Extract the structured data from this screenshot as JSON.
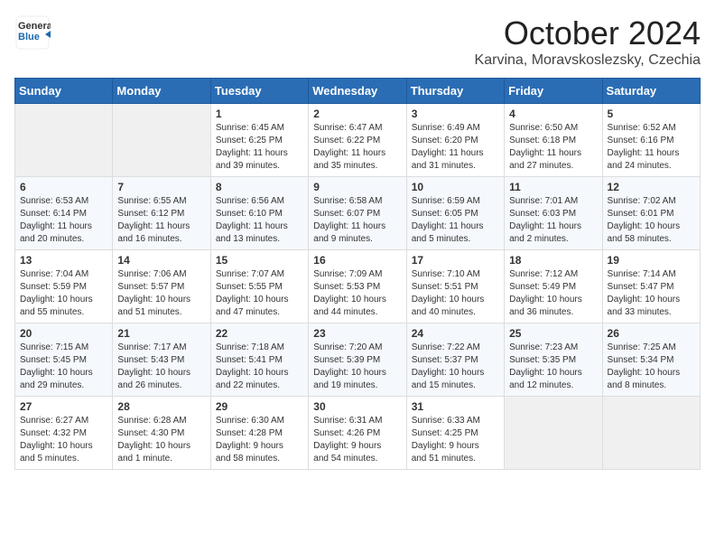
{
  "header": {
    "logo_line1": "General",
    "logo_line2": "Blue",
    "month": "October 2024",
    "location": "Karvina, Moravskoslezsky, Czechia"
  },
  "weekdays": [
    "Sunday",
    "Monday",
    "Tuesday",
    "Wednesday",
    "Thursday",
    "Friday",
    "Saturday"
  ],
  "weeks": [
    [
      {
        "day": "",
        "info": ""
      },
      {
        "day": "",
        "info": ""
      },
      {
        "day": "1",
        "info": "Sunrise: 6:45 AM\nSunset: 6:25 PM\nDaylight: 11 hours\nand 39 minutes."
      },
      {
        "day": "2",
        "info": "Sunrise: 6:47 AM\nSunset: 6:22 PM\nDaylight: 11 hours\nand 35 minutes."
      },
      {
        "day": "3",
        "info": "Sunrise: 6:49 AM\nSunset: 6:20 PM\nDaylight: 11 hours\nand 31 minutes."
      },
      {
        "day": "4",
        "info": "Sunrise: 6:50 AM\nSunset: 6:18 PM\nDaylight: 11 hours\nand 27 minutes."
      },
      {
        "day": "5",
        "info": "Sunrise: 6:52 AM\nSunset: 6:16 PM\nDaylight: 11 hours\nand 24 minutes."
      }
    ],
    [
      {
        "day": "6",
        "info": "Sunrise: 6:53 AM\nSunset: 6:14 PM\nDaylight: 11 hours\nand 20 minutes."
      },
      {
        "day": "7",
        "info": "Sunrise: 6:55 AM\nSunset: 6:12 PM\nDaylight: 11 hours\nand 16 minutes."
      },
      {
        "day": "8",
        "info": "Sunrise: 6:56 AM\nSunset: 6:10 PM\nDaylight: 11 hours\nand 13 minutes."
      },
      {
        "day": "9",
        "info": "Sunrise: 6:58 AM\nSunset: 6:07 PM\nDaylight: 11 hours\nand 9 minutes."
      },
      {
        "day": "10",
        "info": "Sunrise: 6:59 AM\nSunset: 6:05 PM\nDaylight: 11 hours\nand 5 minutes."
      },
      {
        "day": "11",
        "info": "Sunrise: 7:01 AM\nSunset: 6:03 PM\nDaylight: 11 hours\nand 2 minutes."
      },
      {
        "day": "12",
        "info": "Sunrise: 7:02 AM\nSunset: 6:01 PM\nDaylight: 10 hours\nand 58 minutes."
      }
    ],
    [
      {
        "day": "13",
        "info": "Sunrise: 7:04 AM\nSunset: 5:59 PM\nDaylight: 10 hours\nand 55 minutes."
      },
      {
        "day": "14",
        "info": "Sunrise: 7:06 AM\nSunset: 5:57 PM\nDaylight: 10 hours\nand 51 minutes."
      },
      {
        "day": "15",
        "info": "Sunrise: 7:07 AM\nSunset: 5:55 PM\nDaylight: 10 hours\nand 47 minutes."
      },
      {
        "day": "16",
        "info": "Sunrise: 7:09 AM\nSunset: 5:53 PM\nDaylight: 10 hours\nand 44 minutes."
      },
      {
        "day": "17",
        "info": "Sunrise: 7:10 AM\nSunset: 5:51 PM\nDaylight: 10 hours\nand 40 minutes."
      },
      {
        "day": "18",
        "info": "Sunrise: 7:12 AM\nSunset: 5:49 PM\nDaylight: 10 hours\nand 36 minutes."
      },
      {
        "day": "19",
        "info": "Sunrise: 7:14 AM\nSunset: 5:47 PM\nDaylight: 10 hours\nand 33 minutes."
      }
    ],
    [
      {
        "day": "20",
        "info": "Sunrise: 7:15 AM\nSunset: 5:45 PM\nDaylight: 10 hours\nand 29 minutes."
      },
      {
        "day": "21",
        "info": "Sunrise: 7:17 AM\nSunset: 5:43 PM\nDaylight: 10 hours\nand 26 minutes."
      },
      {
        "day": "22",
        "info": "Sunrise: 7:18 AM\nSunset: 5:41 PM\nDaylight: 10 hours\nand 22 minutes."
      },
      {
        "day": "23",
        "info": "Sunrise: 7:20 AM\nSunset: 5:39 PM\nDaylight: 10 hours\nand 19 minutes."
      },
      {
        "day": "24",
        "info": "Sunrise: 7:22 AM\nSunset: 5:37 PM\nDaylight: 10 hours\nand 15 minutes."
      },
      {
        "day": "25",
        "info": "Sunrise: 7:23 AM\nSunset: 5:35 PM\nDaylight: 10 hours\nand 12 minutes."
      },
      {
        "day": "26",
        "info": "Sunrise: 7:25 AM\nSunset: 5:34 PM\nDaylight: 10 hours\nand 8 minutes."
      }
    ],
    [
      {
        "day": "27",
        "info": "Sunrise: 6:27 AM\nSunset: 4:32 PM\nDaylight: 10 hours\nand 5 minutes."
      },
      {
        "day": "28",
        "info": "Sunrise: 6:28 AM\nSunset: 4:30 PM\nDaylight: 10 hours\nand 1 minute."
      },
      {
        "day": "29",
        "info": "Sunrise: 6:30 AM\nSunset: 4:28 PM\nDaylight: 9 hours\nand 58 minutes."
      },
      {
        "day": "30",
        "info": "Sunrise: 6:31 AM\nSunset: 4:26 PM\nDaylight: 9 hours\nand 54 minutes."
      },
      {
        "day": "31",
        "info": "Sunrise: 6:33 AM\nSunset: 4:25 PM\nDaylight: 9 hours\nand 51 minutes."
      },
      {
        "day": "",
        "info": ""
      },
      {
        "day": "",
        "info": ""
      }
    ]
  ]
}
